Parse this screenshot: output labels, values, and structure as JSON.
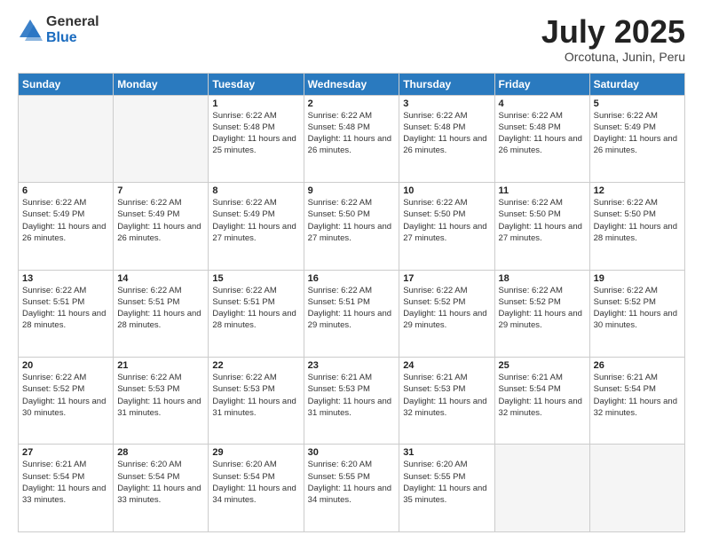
{
  "header": {
    "logo_general": "General",
    "logo_blue": "Blue",
    "title": "July 2025",
    "location": "Orcotuna, Junin, Peru"
  },
  "weekdays": [
    "Sunday",
    "Monday",
    "Tuesday",
    "Wednesday",
    "Thursday",
    "Friday",
    "Saturday"
  ],
  "weeks": [
    [
      {
        "day": "",
        "empty": true
      },
      {
        "day": "",
        "empty": true
      },
      {
        "day": "1",
        "sunrise": "Sunrise: 6:22 AM",
        "sunset": "Sunset: 5:48 PM",
        "daylight": "Daylight: 11 hours and 25 minutes."
      },
      {
        "day": "2",
        "sunrise": "Sunrise: 6:22 AM",
        "sunset": "Sunset: 5:48 PM",
        "daylight": "Daylight: 11 hours and 26 minutes."
      },
      {
        "day": "3",
        "sunrise": "Sunrise: 6:22 AM",
        "sunset": "Sunset: 5:48 PM",
        "daylight": "Daylight: 11 hours and 26 minutes."
      },
      {
        "day": "4",
        "sunrise": "Sunrise: 6:22 AM",
        "sunset": "Sunset: 5:48 PM",
        "daylight": "Daylight: 11 hours and 26 minutes."
      },
      {
        "day": "5",
        "sunrise": "Sunrise: 6:22 AM",
        "sunset": "Sunset: 5:49 PM",
        "daylight": "Daylight: 11 hours and 26 minutes."
      }
    ],
    [
      {
        "day": "6",
        "sunrise": "Sunrise: 6:22 AM",
        "sunset": "Sunset: 5:49 PM",
        "daylight": "Daylight: 11 hours and 26 minutes."
      },
      {
        "day": "7",
        "sunrise": "Sunrise: 6:22 AM",
        "sunset": "Sunset: 5:49 PM",
        "daylight": "Daylight: 11 hours and 26 minutes."
      },
      {
        "day": "8",
        "sunrise": "Sunrise: 6:22 AM",
        "sunset": "Sunset: 5:49 PM",
        "daylight": "Daylight: 11 hours and 27 minutes."
      },
      {
        "day": "9",
        "sunrise": "Sunrise: 6:22 AM",
        "sunset": "Sunset: 5:50 PM",
        "daylight": "Daylight: 11 hours and 27 minutes."
      },
      {
        "day": "10",
        "sunrise": "Sunrise: 6:22 AM",
        "sunset": "Sunset: 5:50 PM",
        "daylight": "Daylight: 11 hours and 27 minutes."
      },
      {
        "day": "11",
        "sunrise": "Sunrise: 6:22 AM",
        "sunset": "Sunset: 5:50 PM",
        "daylight": "Daylight: 11 hours and 27 minutes."
      },
      {
        "day": "12",
        "sunrise": "Sunrise: 6:22 AM",
        "sunset": "Sunset: 5:50 PM",
        "daylight": "Daylight: 11 hours and 28 minutes."
      }
    ],
    [
      {
        "day": "13",
        "sunrise": "Sunrise: 6:22 AM",
        "sunset": "Sunset: 5:51 PM",
        "daylight": "Daylight: 11 hours and 28 minutes."
      },
      {
        "day": "14",
        "sunrise": "Sunrise: 6:22 AM",
        "sunset": "Sunset: 5:51 PM",
        "daylight": "Daylight: 11 hours and 28 minutes."
      },
      {
        "day": "15",
        "sunrise": "Sunrise: 6:22 AM",
        "sunset": "Sunset: 5:51 PM",
        "daylight": "Daylight: 11 hours and 28 minutes."
      },
      {
        "day": "16",
        "sunrise": "Sunrise: 6:22 AM",
        "sunset": "Sunset: 5:51 PM",
        "daylight": "Daylight: 11 hours and 29 minutes."
      },
      {
        "day": "17",
        "sunrise": "Sunrise: 6:22 AM",
        "sunset": "Sunset: 5:52 PM",
        "daylight": "Daylight: 11 hours and 29 minutes."
      },
      {
        "day": "18",
        "sunrise": "Sunrise: 6:22 AM",
        "sunset": "Sunset: 5:52 PM",
        "daylight": "Daylight: 11 hours and 29 minutes."
      },
      {
        "day": "19",
        "sunrise": "Sunrise: 6:22 AM",
        "sunset": "Sunset: 5:52 PM",
        "daylight": "Daylight: 11 hours and 30 minutes."
      }
    ],
    [
      {
        "day": "20",
        "sunrise": "Sunrise: 6:22 AM",
        "sunset": "Sunset: 5:52 PM",
        "daylight": "Daylight: 11 hours and 30 minutes."
      },
      {
        "day": "21",
        "sunrise": "Sunrise: 6:22 AM",
        "sunset": "Sunset: 5:53 PM",
        "daylight": "Daylight: 11 hours and 31 minutes."
      },
      {
        "day": "22",
        "sunrise": "Sunrise: 6:22 AM",
        "sunset": "Sunset: 5:53 PM",
        "daylight": "Daylight: 11 hours and 31 minutes."
      },
      {
        "day": "23",
        "sunrise": "Sunrise: 6:21 AM",
        "sunset": "Sunset: 5:53 PM",
        "daylight": "Daylight: 11 hours and 31 minutes."
      },
      {
        "day": "24",
        "sunrise": "Sunrise: 6:21 AM",
        "sunset": "Sunset: 5:53 PM",
        "daylight": "Daylight: 11 hours and 32 minutes."
      },
      {
        "day": "25",
        "sunrise": "Sunrise: 6:21 AM",
        "sunset": "Sunset: 5:54 PM",
        "daylight": "Daylight: 11 hours and 32 minutes."
      },
      {
        "day": "26",
        "sunrise": "Sunrise: 6:21 AM",
        "sunset": "Sunset: 5:54 PM",
        "daylight": "Daylight: 11 hours and 32 minutes."
      }
    ],
    [
      {
        "day": "27",
        "sunrise": "Sunrise: 6:21 AM",
        "sunset": "Sunset: 5:54 PM",
        "daylight": "Daylight: 11 hours and 33 minutes."
      },
      {
        "day": "28",
        "sunrise": "Sunrise: 6:20 AM",
        "sunset": "Sunset: 5:54 PM",
        "daylight": "Daylight: 11 hours and 33 minutes."
      },
      {
        "day": "29",
        "sunrise": "Sunrise: 6:20 AM",
        "sunset": "Sunset: 5:54 PM",
        "daylight": "Daylight: 11 hours and 34 minutes."
      },
      {
        "day": "30",
        "sunrise": "Sunrise: 6:20 AM",
        "sunset": "Sunset: 5:55 PM",
        "daylight": "Daylight: 11 hours and 34 minutes."
      },
      {
        "day": "31",
        "sunrise": "Sunrise: 6:20 AM",
        "sunset": "Sunset: 5:55 PM",
        "daylight": "Daylight: 11 hours and 35 minutes."
      },
      {
        "day": "",
        "empty": true
      },
      {
        "day": "",
        "empty": true
      }
    ]
  ]
}
